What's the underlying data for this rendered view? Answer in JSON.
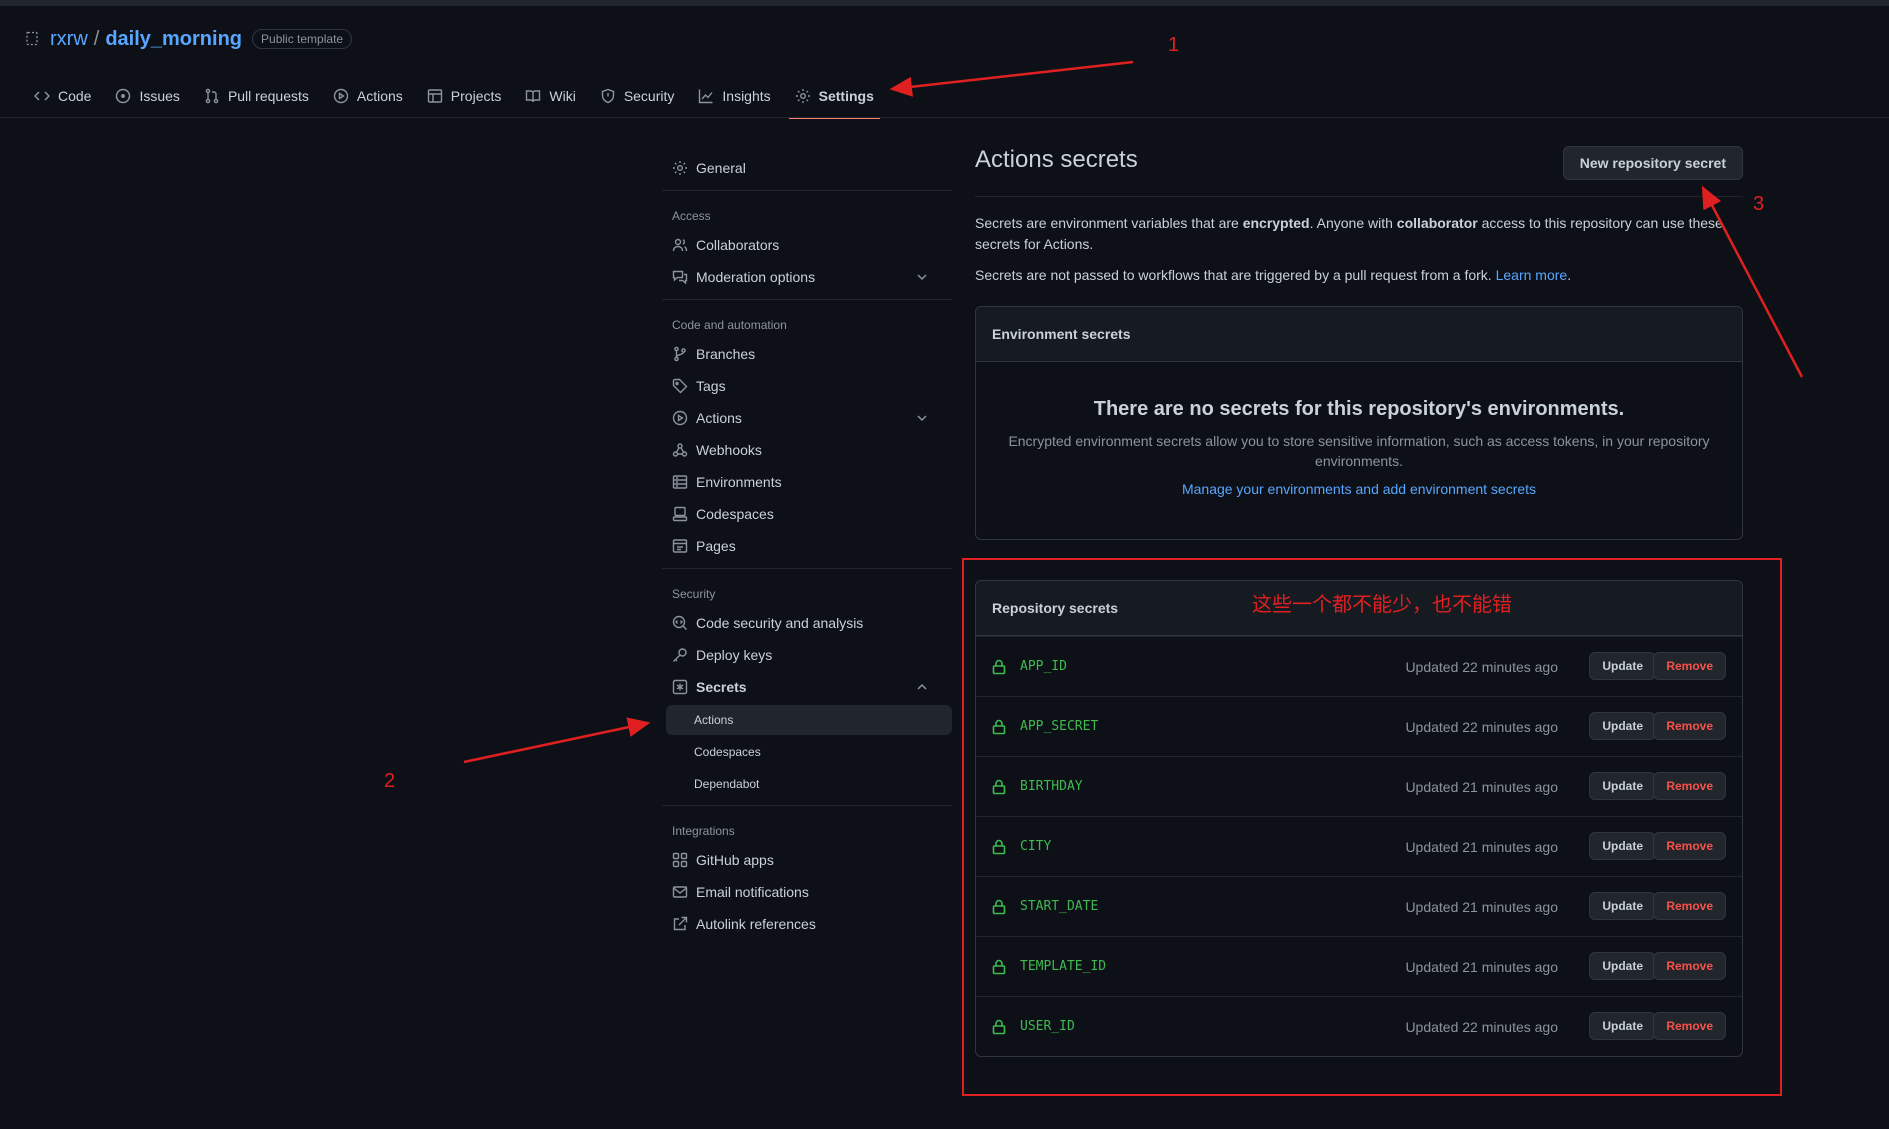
{
  "repo": {
    "owner": "rxrw",
    "separator": "/",
    "name": "daily_morning",
    "badge": "Public template"
  },
  "tabs": [
    {
      "label": "Code",
      "icon": "code-icon"
    },
    {
      "label": "Issues",
      "icon": "issue-icon"
    },
    {
      "label": "Pull requests",
      "icon": "pull-request-icon"
    },
    {
      "label": "Actions",
      "icon": "play-icon"
    },
    {
      "label": "Projects",
      "icon": "table-icon"
    },
    {
      "label": "Wiki",
      "icon": "book-icon"
    },
    {
      "label": "Security",
      "icon": "shield-icon"
    },
    {
      "label": "Insights",
      "icon": "graph-icon"
    },
    {
      "label": "Settings",
      "icon": "gear-icon",
      "active": true
    }
  ],
  "sidebar": {
    "general": "General",
    "access_heading": "Access",
    "collaborators": "Collaborators",
    "moderation": "Moderation options",
    "code_heading": "Code and automation",
    "branches": "Branches",
    "tags": "Tags",
    "actions": "Actions",
    "webhooks": "Webhooks",
    "environments": "Environments",
    "codespaces": "Codespaces",
    "pages": "Pages",
    "security_heading": "Security",
    "code_security": "Code security and analysis",
    "deploy_keys": "Deploy keys",
    "secrets": "Secrets",
    "secrets_sub": [
      "Actions",
      "Codespaces",
      "Dependabot"
    ],
    "integrations_heading": "Integrations",
    "github_apps": "GitHub apps",
    "email_notifications": "Email notifications",
    "autolink": "Autolink references"
  },
  "main": {
    "title": "Actions secrets",
    "new_button": "New repository secret",
    "para1_a": "Secrets are environment variables that are ",
    "para1_b": "encrypted",
    "para1_c": ". Anyone with ",
    "para1_d": "collaborator",
    "para1_e": " access to this repository can use these secrets for Actions.",
    "para2_a": "Secrets are not passed to workflows that are triggered by a pull request from a fork. ",
    "para2_link": "Learn more",
    "para2_end": ".",
    "env_heading": "Environment secrets",
    "env_empty_title": "There are no secrets for this repository's environments.",
    "env_empty_desc": "Encrypted environment secrets allow you to store sensitive information, such as access tokens, in your repository environments.",
    "env_link": "Manage your environments and add environment secrets",
    "repo_heading": "Repository secrets",
    "secrets": [
      {
        "name": "APP_ID",
        "updated": "Updated 22 minutes ago"
      },
      {
        "name": "APP_SECRET",
        "updated": "Updated 22 minutes ago"
      },
      {
        "name": "BIRTHDAY",
        "updated": "Updated 21 minutes ago"
      },
      {
        "name": "CITY",
        "updated": "Updated 21 minutes ago"
      },
      {
        "name": "START_DATE",
        "updated": "Updated 21 minutes ago"
      },
      {
        "name": "TEMPLATE_ID",
        "updated": "Updated 21 minutes ago"
      },
      {
        "name": "USER_ID",
        "updated": "Updated 22 minutes ago"
      }
    ],
    "update_label": "Update",
    "remove_label": "Remove"
  },
  "annotations": {
    "n1": "1",
    "n2": "2",
    "n3": "3",
    "note": "这些一个都不能少，也不能错",
    "color": "#e02020"
  }
}
